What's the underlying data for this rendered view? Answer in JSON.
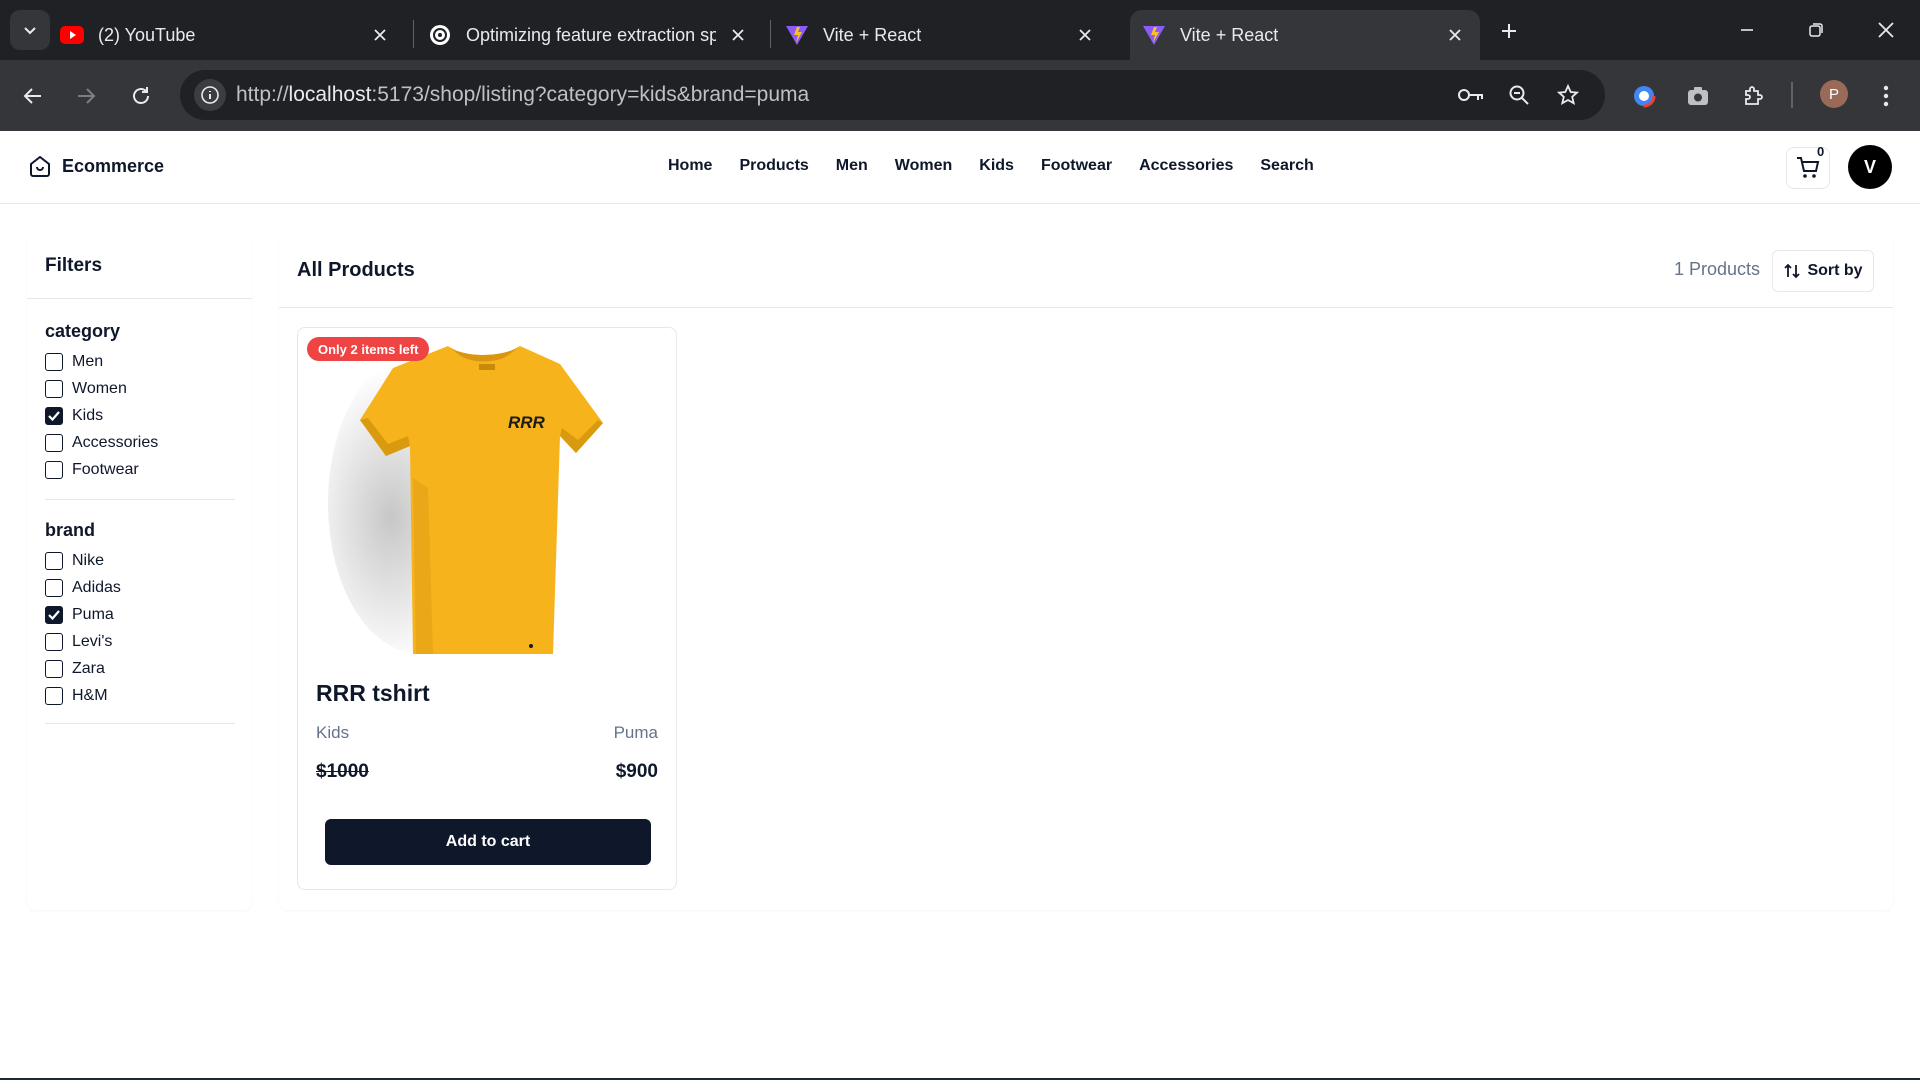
{
  "browser": {
    "tabs": [
      {
        "title": "(2) YouTube",
        "icon": "youtube-icon"
      },
      {
        "title": "Optimizing feature extraction sp",
        "icon": "openai-icon"
      },
      {
        "title": "Vite + React",
        "icon": "vite-icon"
      },
      {
        "title": "Vite + React",
        "icon": "vite-icon",
        "active": true
      }
    ],
    "url_scheme": "http://",
    "url_host": "localhost",
    "url_rest": ":5173/shop/listing?category=kids&brand=puma",
    "profile_initial": "P"
  },
  "header": {
    "brand": "Ecommerce",
    "nav": [
      "Home",
      "Products",
      "Men",
      "Women",
      "Kids",
      "Footwear",
      "Accessories",
      "Search"
    ],
    "cart_count": "0",
    "avatar_initial": "V"
  },
  "filters": {
    "title": "Filters",
    "groups": [
      {
        "title": "category",
        "options": [
          {
            "label": "Men",
            "checked": false
          },
          {
            "label": "Women",
            "checked": false
          },
          {
            "label": "Kids",
            "checked": true
          },
          {
            "label": "Accessories",
            "checked": false
          },
          {
            "label": "Footwear",
            "checked": false
          }
        ]
      },
      {
        "title": "brand",
        "options": [
          {
            "label": "Nike",
            "checked": false
          },
          {
            "label": "Adidas",
            "checked": false
          },
          {
            "label": "Puma",
            "checked": true
          },
          {
            "label": "Levi's",
            "checked": false
          },
          {
            "label": "Zara",
            "checked": false
          },
          {
            "label": "H&M",
            "checked": false
          }
        ]
      }
    ]
  },
  "listing": {
    "title": "All Products",
    "count_label": "1 Products",
    "sort_label": "Sort by",
    "products": [
      {
        "badge": "Only 2 items left",
        "name": "RRR tshirt",
        "category": "Kids",
        "brand": "Puma",
        "price": "$1000",
        "sale_price": "$900",
        "cta": "Add to cart",
        "shirt_print": "RRR",
        "shirt_color": "#f6b31c"
      }
    ]
  }
}
